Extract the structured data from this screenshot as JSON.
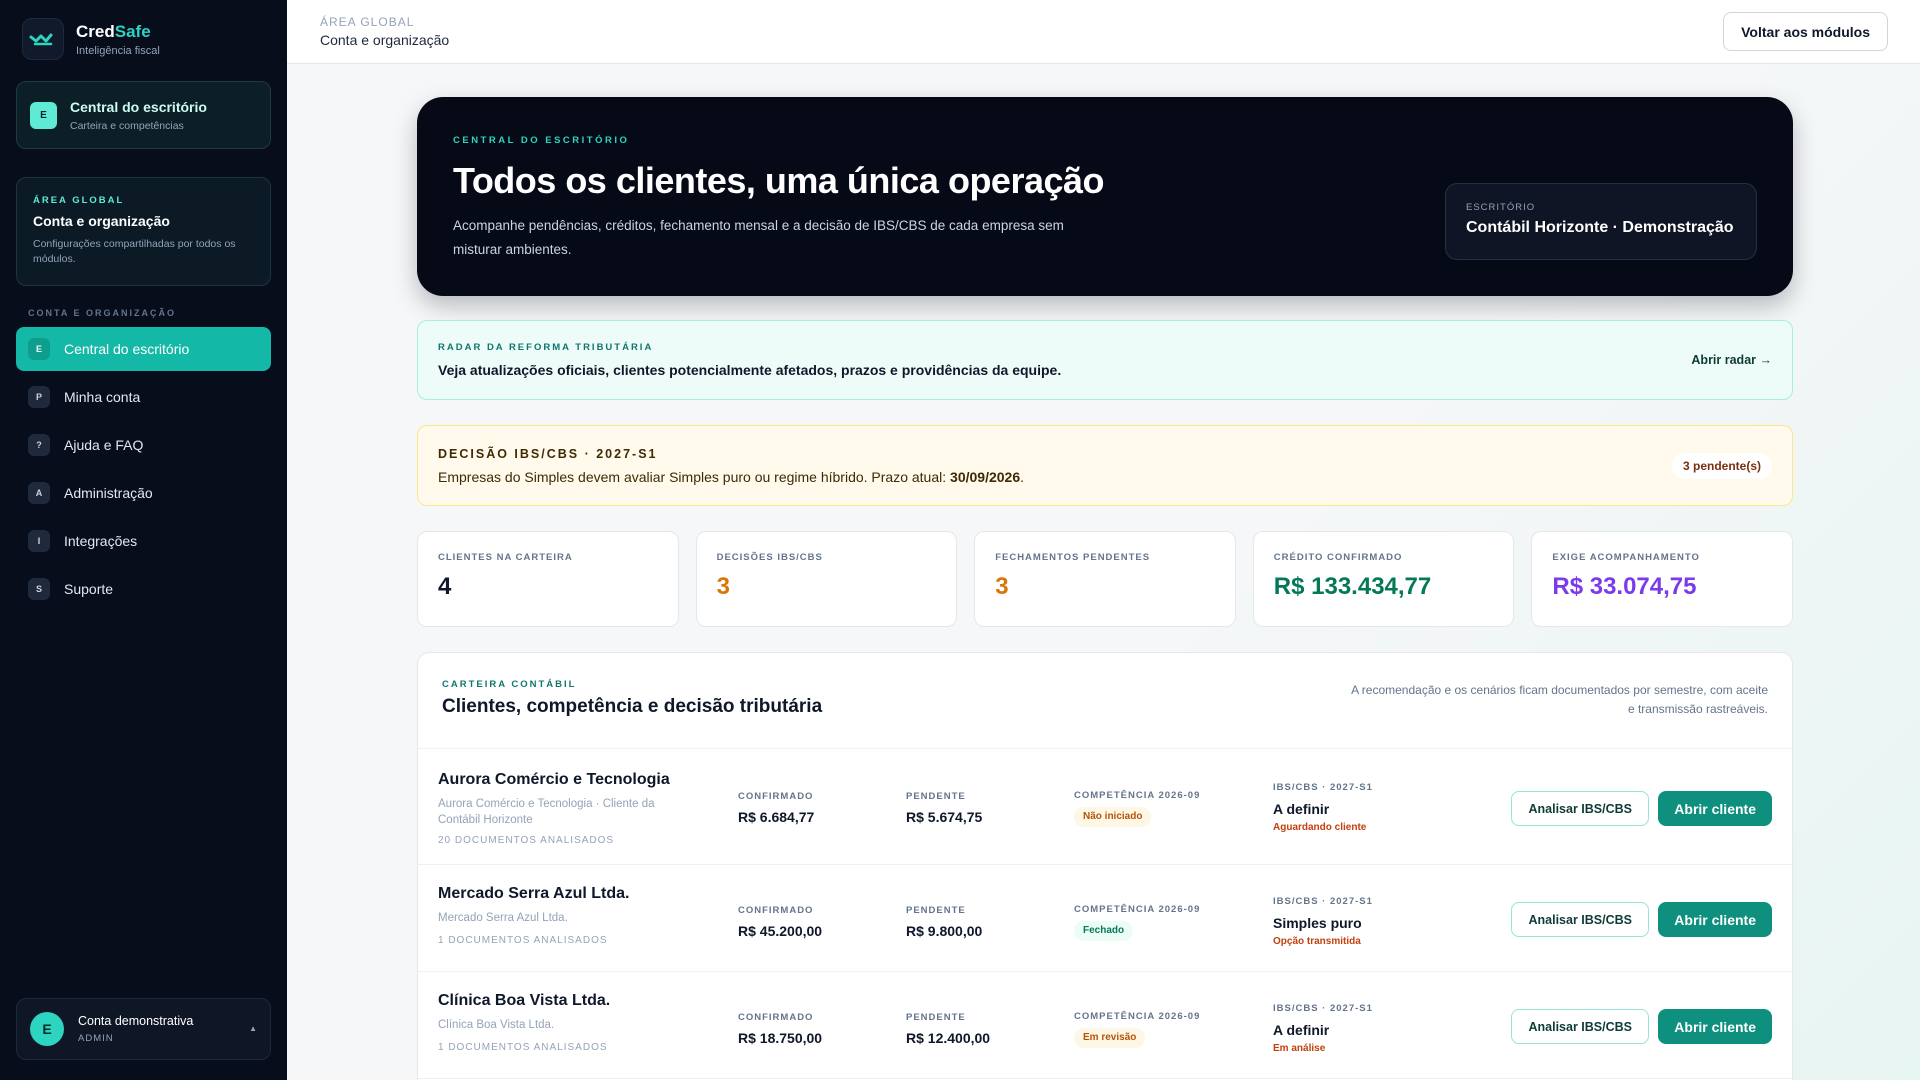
{
  "brand": {
    "name_part1": "Cred",
    "name_part2": "Safe",
    "tagline": "Inteligência fiscal"
  },
  "sidebar": {
    "module": {
      "badge": "E",
      "title": "Central do escritório",
      "subtitle": "Carteira e competências"
    },
    "global": {
      "label": "ÁREA GLOBAL",
      "title": "Conta e organização",
      "description": "Configurações compartilhadas por todos os módulos."
    },
    "section_label": "CONTA E ORGANIZAÇÃO",
    "items": [
      {
        "badge": "E",
        "label": "Central do escritório",
        "active": true
      },
      {
        "badge": "P",
        "label": "Minha conta"
      },
      {
        "badge": "?",
        "label": "Ajuda e FAQ"
      },
      {
        "badge": "A",
        "label": "Administração"
      },
      {
        "badge": "I",
        "label": "Integrações"
      },
      {
        "badge": "S",
        "label": "Suporte"
      }
    ],
    "user": {
      "initial": "E",
      "name": "Conta demonstrativa",
      "role": "ADMIN",
      "caret": "▲"
    }
  },
  "topbar": {
    "crumb_small": "ÁREA GLOBAL",
    "crumb_main": "Conta e organização",
    "back_button": "Voltar aos módulos"
  },
  "hero": {
    "label": "CENTRAL DO ESCRITÓRIO",
    "title": "Todos os clientes, uma única operação",
    "description": "Acompanhe pendências, créditos, fechamento mensal e a decisão de IBS/CBS de cada empresa sem misturar ambientes.",
    "office_label": "ESCRITÓRIO",
    "office_value": "Contábil Horizonte · Demonstração"
  },
  "radar": {
    "label": "RADAR DA REFORMA TRIBUTÁRIA",
    "text": "Veja atualizações oficiais, clientes potencialmente afetados, prazos e providências da equipe.",
    "link": "Abrir radar →"
  },
  "decision": {
    "label": "DECISÃO IBS/CBS · 2027-S1",
    "text": "Empresas do Simples devem avaliar Simples puro ou regime híbrido. Prazo atual: ",
    "deadline": "30/09/2026",
    "suffix": ".",
    "pill": "3 pendente(s)"
  },
  "kpis": [
    {
      "label": "CLIENTES NA CARTEIRA",
      "value": "4",
      "color": "#0f172a"
    },
    {
      "label": "DECISÕES IBS/CBS",
      "value": "3",
      "color": "#d97706"
    },
    {
      "label": "FECHAMENTOS PENDENTES",
      "value": "3",
      "color": "#d97706"
    },
    {
      "label": "CRÉDITO CONFIRMADO",
      "value": "R$ 133.434,77",
      "color": "#047857"
    },
    {
      "label": "EXIGE ACOMPANHAMENTO",
      "value": "R$ 33.074,75",
      "color": "#7c3aed"
    }
  ],
  "portfolio": {
    "label": "CARTEIRA CONTÁBIL",
    "title": "Clientes, competência e decisão tributária",
    "note": "A recomendação e os cenários ficam documentados por semestre, com aceite e transmissão rastreáveis.",
    "col_confirmed": "CONFIRMADO",
    "col_pending": "PENDENTE",
    "col_competence": "COMPETÊNCIA 2026-09",
    "col_decision": "IBS/CBS · 2027-S1",
    "btn_analyze": "Analisar IBS/CBS",
    "btn_open": "Abrir cliente",
    "rows": [
      {
        "name": "Aurora Comércio e Tecnologia",
        "subtitle": "Aurora Comércio e Tecnologia · Cliente da Contábil Horizonte",
        "docs": "20 DOCUMENTOS ANALISADOS",
        "confirmed": "R$ 6.684,77",
        "pending": "R$ 5.674,75",
        "status": "Não iniciado",
        "status_tone": "amber",
        "decision": "A definir",
        "decision_sub": "Aguardando cliente"
      },
      {
        "name": "Mercado Serra Azul Ltda.",
        "subtitle": "Mercado Serra Azul Ltda.",
        "docs": "1 DOCUMENTOS ANALISADOS",
        "confirmed": "R$ 45.200,00",
        "pending": "R$ 9.800,00",
        "status": "Fechado",
        "status_tone": "green",
        "decision": "Simples puro",
        "decision_sub": "Opção transmitida"
      },
      {
        "name": "Clínica Boa Vista Ltda.",
        "subtitle": "Clínica Boa Vista Ltda.",
        "docs": "1 DOCUMENTOS ANALISADOS",
        "confirmed": "R$ 18.750,00",
        "pending": "R$ 12.400,00",
        "status": "Em revisão",
        "status_tone": "amber",
        "decision": "A definir",
        "decision_sub": "Em análise"
      }
    ]
  }
}
